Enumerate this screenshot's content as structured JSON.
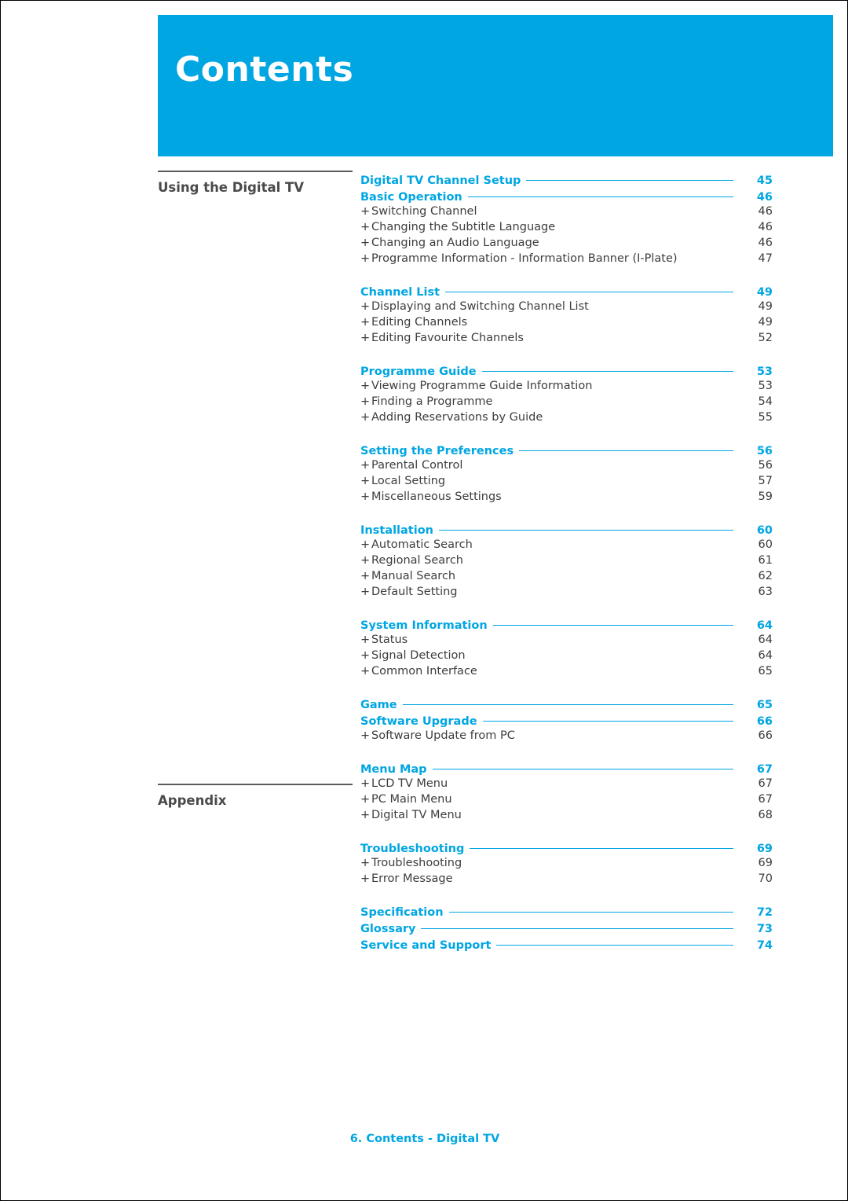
{
  "header": {
    "title": "Contents"
  },
  "left_sections": [
    {
      "label": "Using the Digital TV"
    },
    {
      "label": "Appendix"
    }
  ],
  "groups": [
    {
      "title": "Digital TV Channel Setup",
      "page": "45",
      "entries": []
    },
    {
      "title": "Basic Operation",
      "page": "46",
      "entries": [
        {
          "label": "Switching Channel",
          "page": "46"
        },
        {
          "label": "Changing the Subtitle Language",
          "page": "46"
        },
        {
          "label": "Changing an Audio Language",
          "page": "46"
        },
        {
          "label": "Programme Information - Information Banner (I-Plate)",
          "page": "47"
        }
      ]
    },
    {
      "title": "Channel List",
      "page": "49",
      "entries": [
        {
          "label": "Displaying and Switching Channel List",
          "page": "49"
        },
        {
          "label": "Editing Channels",
          "page": "49"
        },
        {
          "label": "Editing Favourite Channels",
          "page": "52"
        }
      ]
    },
    {
      "title": "Programme Guide",
      "page": "53",
      "entries": [
        {
          "label": "Viewing Programme Guide Information",
          "page": "53"
        },
        {
          "label": "Finding a Programme",
          "page": "54"
        },
        {
          "label": "Adding Reservations by Guide",
          "page": "55"
        }
      ]
    },
    {
      "title": "Setting the Preferences",
      "page": "56",
      "entries": [
        {
          "label": "Parental Control",
          "page": "56"
        },
        {
          "label": "Local Setting",
          "page": "57"
        },
        {
          "label": "Miscellaneous Settings",
          "page": "59"
        }
      ]
    },
    {
      "title": "Installation",
      "page": "60",
      "entries": [
        {
          "label": "Automatic Search",
          "page": "60"
        },
        {
          "label": "Regional Search",
          "page": "61"
        },
        {
          "label": "Manual Search",
          "page": "62"
        },
        {
          "label": "Default Setting",
          "page": "63"
        }
      ]
    },
    {
      "title": "System Information",
      "page": "64",
      "entries": [
        {
          "label": "Status",
          "page": "64"
        },
        {
          "label": "Signal Detection",
          "page": "64"
        },
        {
          "label": "Common Interface",
          "page": "65"
        }
      ]
    },
    {
      "title": "Game",
      "page": "65",
      "entries": []
    },
    {
      "title": "Software Upgrade",
      "page": "66",
      "entries": [
        {
          "label": "Software Update from PC",
          "page": "66"
        }
      ]
    },
    {
      "title": "Menu Map",
      "page": "67",
      "entries": [
        {
          "label": "LCD TV Menu",
          "page": "67"
        },
        {
          "label": "PC Main Menu",
          "page": "67"
        },
        {
          "label": "Digital TV Menu",
          "page": "68"
        }
      ]
    },
    {
      "title": "Troubleshooting",
      "page": "69",
      "entries": [
        {
          "label": "Troubleshooting",
          "page": "69"
        },
        {
          "label": "Error Message",
          "page": "70"
        }
      ]
    },
    {
      "title": "Specification",
      "page": "72",
      "entries": []
    },
    {
      "title": "Glossary",
      "page": "73",
      "entries": []
    },
    {
      "title": "Service and Support",
      "page": "74",
      "entries": []
    }
  ],
  "bullet": "+",
  "footer": {
    "text": "6. Contents - Digital TV"
  },
  "colors": {
    "accent": "#00a6e2",
    "heading_grey": "#4a4a4a",
    "body": "#3d3d3d"
  }
}
